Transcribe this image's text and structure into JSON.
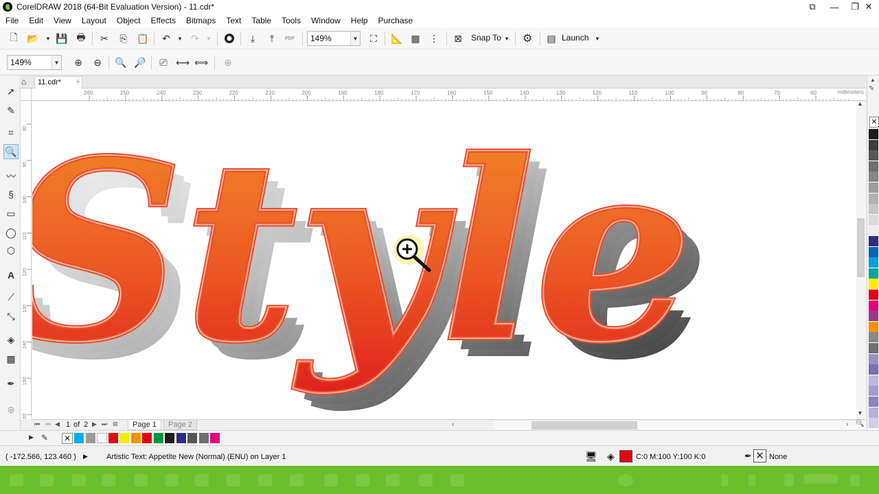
{
  "window": {
    "title": "CorelDRAW 2018 (64-Bit Evaluation Version) - 11.cdr*",
    "controls": [
      "⧉",
      "—",
      "❐",
      "✕"
    ]
  },
  "menubar": {
    "items": [
      "File",
      "Edit",
      "View",
      "Layout",
      "Object",
      "Effects",
      "Bitmaps",
      "Text",
      "Table",
      "Tools",
      "Window",
      "Help",
      "Purchase"
    ]
  },
  "toolbar": {
    "zoom_value": "149%",
    "snap_label": "Snap To",
    "launch_label": "Launch",
    "pdf_label": "PDF"
  },
  "propbar": {
    "zoom_value": "149%"
  },
  "doc_tab": {
    "name": "11.cdr*"
  },
  "ruler": {
    "unit": "millimeters",
    "h_ticks": [
      "260",
      "250",
      "240",
      "230",
      "220",
      "210",
      "200",
      "190",
      "180",
      "170",
      "160",
      "150",
      "140",
      "130",
      "120",
      "110",
      "100",
      "90",
      "80",
      "70",
      "60"
    ],
    "v_ticks": [
      "80",
      "90",
      "100",
      "110",
      "120",
      "130",
      "140",
      "150",
      "160",
      "170",
      "180"
    ]
  },
  "canvas": {
    "artwork_text": "Style"
  },
  "page_nav": {
    "counter_current": "1",
    "counter_of": "of",
    "counter_total": "2",
    "pages": [
      "Page 1",
      "Page 2"
    ]
  },
  "palette": {
    "bottom": [
      "#00aeef",
      "#9b9b9b",
      "#ffffff",
      "#e30613",
      "#ffed00",
      "#f39200",
      "#e30613",
      "#009640",
      "#1d1d1b",
      "#2d2e83",
      "#575756",
      "#706f6f",
      "#e6007e"
    ],
    "right": [
      "#1d1d1b",
      "#3c3c3b",
      "#575756",
      "#706f6f",
      "#878787",
      "#9d9d9c",
      "#b2b2b2",
      "#c6c6c6",
      "#dadada",
      "#ededed",
      "#2d2e83",
      "#0069b4",
      "#009fe3",
      "#00a99d",
      "#ffed00",
      "#e30613",
      "#e6007e",
      "#9d3987",
      "#f39200",
      "#878787",
      "#706f6f",
      "#9b8fc2",
      "#7a6fb0",
      "#c0b5dc",
      "#a69bcf",
      "#8f84c2",
      "#b9b0dc",
      "#d4cde8"
    ]
  },
  "status": {
    "coords": "( -172.566, 123.460 )",
    "object_info": "Artistic Text: Appetite New (Normal) (ENU) on Layer 1",
    "fill_color": "#e30613",
    "fill_label": "C:0 M:100 Y:100 K:0",
    "outline_label": "None"
  },
  "taskbar": {
    "color": "#6abf2a"
  }
}
